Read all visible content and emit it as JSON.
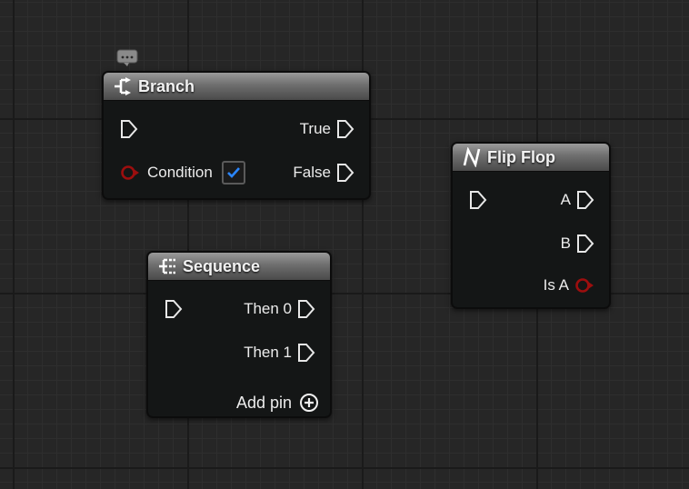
{
  "nodes": {
    "branch": {
      "title": "Branch",
      "icon": "branch-icon",
      "pins": {
        "condition_label": "Condition",
        "condition_checked": true,
        "true_label": "True",
        "false_label": "False"
      }
    },
    "sequence": {
      "title": "Sequence",
      "icon": "sequence-icon",
      "pins": {
        "then0_label": "Then 0",
        "then1_label": "Then 1",
        "add_pin_label": "Add pin"
      }
    },
    "flipflop": {
      "title": "Flip Flop",
      "icon": "flipflop-icon",
      "pins": {
        "a_label": "A",
        "b_label": "B",
        "is_a_label": "Is A"
      }
    }
  },
  "colors": {
    "bool_pin": "#9c0e0e",
    "checkbox_check": "#2a86ff",
    "exec_pin": "#e8e8e8"
  }
}
